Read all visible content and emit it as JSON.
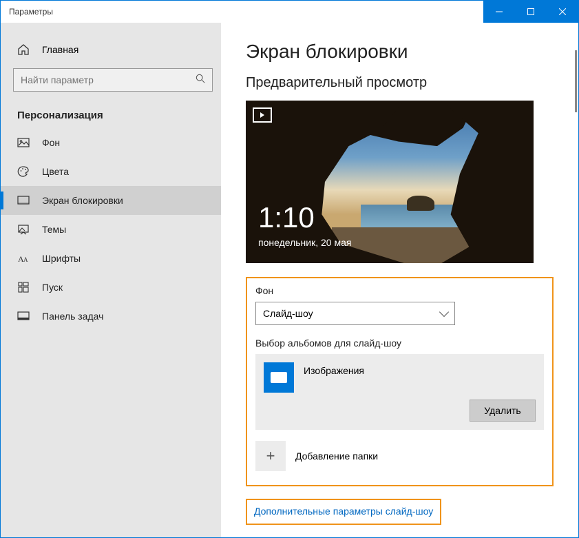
{
  "window": {
    "title": "Параметры"
  },
  "sidebar": {
    "home_label": "Главная",
    "search_placeholder": "Найти параметр",
    "category": "Персонализация",
    "items": [
      {
        "label": "Фон"
      },
      {
        "label": "Цвета"
      },
      {
        "label": "Экран блокировки"
      },
      {
        "label": "Темы"
      },
      {
        "label": "Шрифты"
      },
      {
        "label": "Пуск"
      },
      {
        "label": "Панель задач"
      }
    ]
  },
  "page": {
    "title": "Экран блокировки",
    "preview_heading": "Предварительный просмотр",
    "preview": {
      "time": "1:10",
      "date": "понедельник, 20 мая"
    },
    "background_label": "Фон",
    "background_selected": "Слайд-шоу",
    "albums_label": "Выбор альбомов для слайд-шоу",
    "album": {
      "title": "Изображения",
      "delete": "Удалить"
    },
    "add_folder_label": "Добавление папки",
    "advanced_link": "Дополнительные параметры слайд-шоу"
  }
}
